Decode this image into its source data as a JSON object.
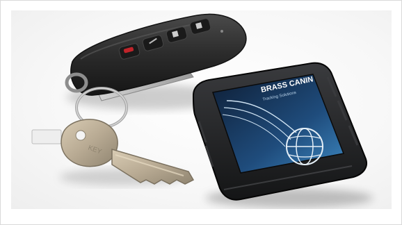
{
  "image": {
    "subject": "key fob, car key on ring, and black GPS tracker device",
    "tracker_label": "BRASS CANIN",
    "tracker_sublabel": "Tracking Solutions"
  },
  "colors": {
    "background": "#ffffff",
    "border": "#d9d9d9",
    "fob_body": "#2b2b2b",
    "fob_button_red": "#c0242a",
    "key_metal": "#b8aa93",
    "tracker_body": "#1f2022",
    "tracker_label_bg": "#2d6fa3"
  }
}
